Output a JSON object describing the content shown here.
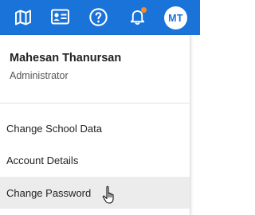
{
  "topbar": {
    "icons": [
      "map-icon",
      "id-card-icon",
      "help-circle-icon",
      "bell-icon"
    ],
    "notification_dot_color": "#ff8a1f",
    "brand_color": "#1a73d9",
    "avatar_initials": "MT"
  },
  "user": {
    "name": "Mahesan Thanursan",
    "role": "Administrator"
  },
  "menu": {
    "items": [
      {
        "label": "Change School Data"
      },
      {
        "label": "Account Details"
      },
      {
        "label": "Change Password",
        "hovered": true
      }
    ]
  },
  "cursor": "pointer-hand-icon"
}
